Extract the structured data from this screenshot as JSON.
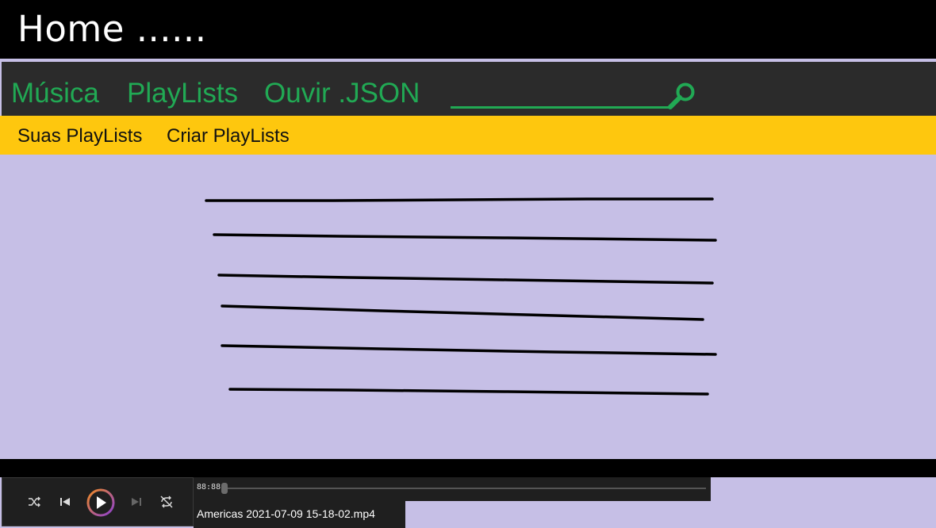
{
  "window": {
    "title": "Home ......"
  },
  "nav": {
    "items": [
      {
        "label": "Música"
      },
      {
        "label": "PlayLists"
      },
      {
        "label": "Ouvir .JSON"
      }
    ],
    "search_icon": "search-icon"
  },
  "subnav": {
    "items": [
      {
        "label": "Suas PlayLists"
      },
      {
        "label": "Criar PlayLists"
      }
    ]
  },
  "player": {
    "controls": [
      "shuffle-icon",
      "previous-icon",
      "play-icon",
      "next-icon",
      "repeat-icon"
    ],
    "time": "88:88",
    "progress": 0,
    "file_name": "Americas 2021-07-09 15-18-02.mp4"
  },
  "colors": {
    "titlebar": "#000000",
    "navbar": "#2b2b2b",
    "nav_text": "#21a954",
    "subbar": "#fec70e",
    "content": "#c6bfe6"
  }
}
